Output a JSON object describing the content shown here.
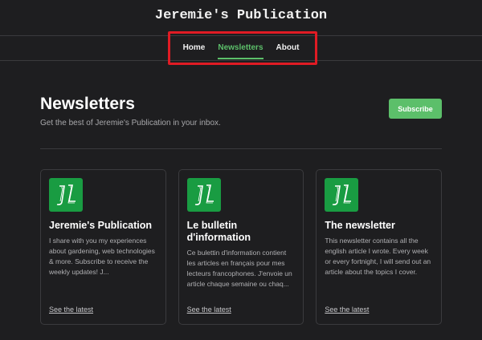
{
  "header": {
    "site_title": "Jeremie's Publication"
  },
  "nav": {
    "items": [
      {
        "label": "Home"
      },
      {
        "label": "Newsletters"
      },
      {
        "label": "About"
      }
    ],
    "active": "Newsletters",
    "accent": "#5cbf6a",
    "highlight_color": "#e01b24"
  },
  "main": {
    "title": "Newsletters",
    "subtitle": "Get the best of Jeremie's Publication in your inbox.",
    "subscribe_label": "Subscribe"
  },
  "cards": [
    {
      "title": "Jeremie's Publication",
      "description": "I share with you my experiences about gardening, web technologies & more. Subscribe to receive the weekly updates! J...",
      "link": "See the latest"
    },
    {
      "title": "Le bulletin d'information",
      "description": "Ce bulettin d'information contient les articles en français pour mes lecteurs francophones. J'envoie un article chaque semaine ou chaq...",
      "link": "See the latest"
    },
    {
      "title": "The newsletter",
      "description": "This newsletter contains all the english article I wrote. Every week or every fortnight, I will send out an article about the topics I cover.",
      "link": "See the latest"
    }
  ],
  "logo_icon": "jl-monogram-icon",
  "logo_color": "#199c42"
}
